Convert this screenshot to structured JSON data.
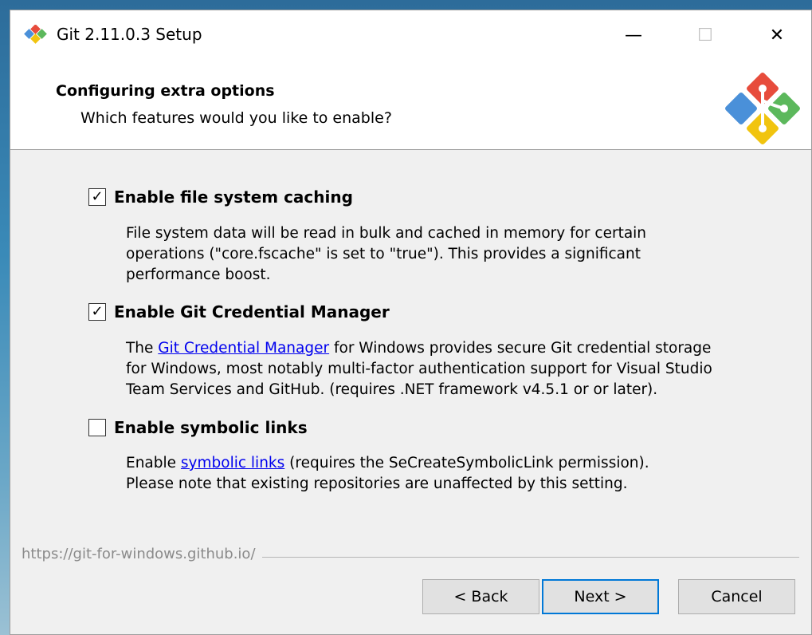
{
  "window": {
    "title": "Git 2.11.0.3 Setup",
    "controls": {
      "minimize": "—",
      "maximize": "☐",
      "close": "✕"
    }
  },
  "header": {
    "title": "Configuring extra options",
    "subtitle": "Which features would you like to enable?"
  },
  "options": [
    {
      "label": "Enable file system caching",
      "checked": true,
      "description": [
        "File system data will be read in bulk and cached in memory for certain",
        "operations (\"core.fscache\" is set to \"true\"). This provides a significant",
        "performance boost."
      ]
    },
    {
      "label": "Enable Git Credential Manager",
      "checked": true,
      "desc_prefix": "The ",
      "desc_link": "Git Credential Manager",
      "desc_suffix": " for Windows provides secure Git credential storage",
      "description_rest": [
        "for Windows, most notably multi-factor authentication support for Visual Studio",
        "Team Services and GitHub. (requires .NET framework v4.5.1 or or later)."
      ]
    },
    {
      "label": "Enable symbolic links",
      "checked": false,
      "desc_prefix": "Enable ",
      "desc_link": "symbolic links",
      "desc_suffix": " (requires the SeCreateSymbolicLink permission).",
      "description_rest": [
        "Please note that existing repositories are unaffected by this setting."
      ]
    }
  ],
  "footer": {
    "url": "https://git-for-windows.github.io/",
    "back_label": "< Back",
    "next_label": "Next >",
    "cancel_label": "Cancel"
  },
  "colors": {
    "link": "#0000ee",
    "focus_border": "#0078d7"
  }
}
